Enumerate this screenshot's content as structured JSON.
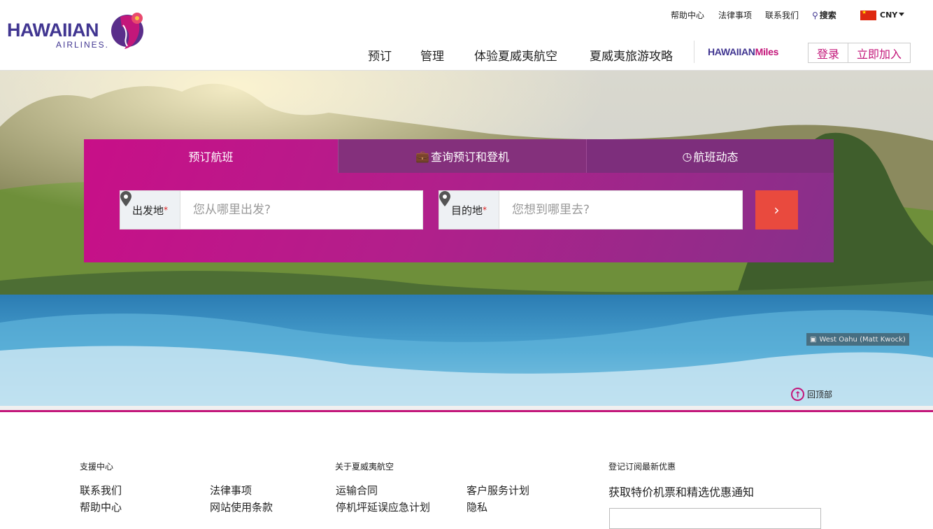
{
  "logo": {
    "word": "HAWAIIAN",
    "sub": "AIRLINES."
  },
  "utility": {
    "help": "帮助中心",
    "legal": "法律事项",
    "contact": "联系我们",
    "search": "搜索",
    "currency": "CNY"
  },
  "nav": {
    "items": [
      "预订",
      "管理",
      "体验夏威夷航空",
      "夏威夷旅游攻略"
    ],
    "miles_a": "HAWAIIAN",
    "miles_b": "Miles",
    "login": "登录",
    "join": "立即加入"
  },
  "booking": {
    "tabs": [
      "预订航班",
      "查询预订和登机",
      "航班动态"
    ],
    "origin_label": "出发地",
    "origin_placeholder": "您从哪里出发?",
    "dest_label": "目的地",
    "dest_placeholder": "您想到哪里去?",
    "required_mark": "*"
  },
  "hero": {
    "credit": "West Oahu (Matt Kwock)",
    "back_to_top": "回顶部"
  },
  "footer": {
    "support_head": "支援中心",
    "about_head": "关于夏威夷航空",
    "subscribe_head": "登记订阅最新优惠",
    "support_col1": [
      "联系我们",
      "帮助中心"
    ],
    "support_col2": [
      "法律事项",
      "网站使用条款"
    ],
    "about_col1": [
      "运输合同",
      "停机坪延误应急计划"
    ],
    "about_col2": [
      "客户服务计划",
      "隐私"
    ],
    "newsletter": "获取特价机票和精选优惠通知"
  },
  "colors": {
    "brand_purple": "#413691",
    "brand_magenta": "#c3177a",
    "go_button": "#e94a3e"
  }
}
